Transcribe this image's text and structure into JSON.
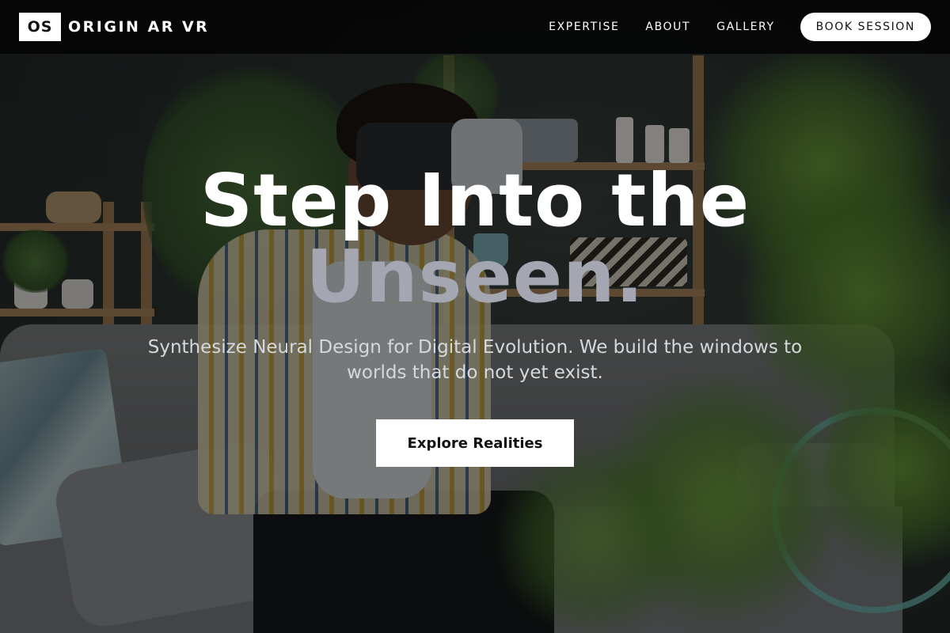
{
  "nav": {
    "logo_mark": "OS",
    "brand": "ORIGIN AR VR",
    "links": [
      "EXPERTISE",
      "ABOUT",
      "GALLERY"
    ],
    "cta_label": "BOOK SESSION"
  },
  "hero": {
    "headline_line1": "Step Into the",
    "headline_line2": "Unseen.",
    "subtitle": "Synthesize Neural Design for Digital Evolution. We build the windows to worlds that do not yet exist.",
    "cta_label": "Explore Realities",
    "background_image": "person-wearing-vr-headset-on-sofa-photo"
  },
  "colors": {
    "nav_bg": "#050505",
    "headline_primary": "#ffffff",
    "headline_secondary": "#a4a7b2",
    "button_bg": "#ffffff",
    "button_text": "#111111"
  }
}
